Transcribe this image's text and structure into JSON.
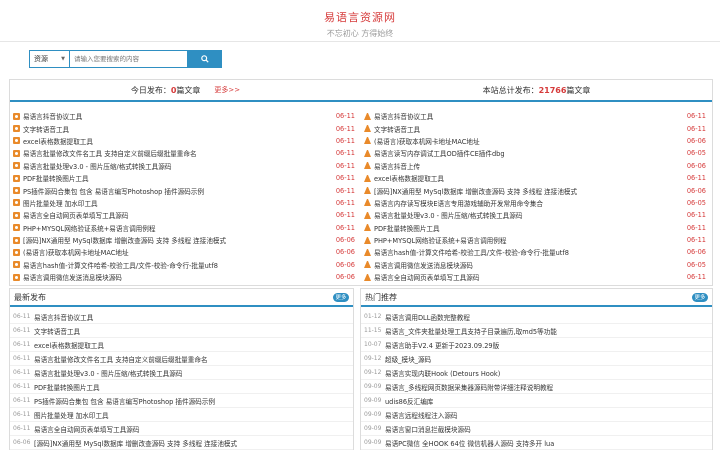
{
  "header": {
    "title": "易语言资源网",
    "slogan": "不忘初心 方得始终"
  },
  "search": {
    "select_value": "资源",
    "placeholder": "请输入您要搜索的内容"
  },
  "top": {
    "left_prefix": "今日发布：",
    "left_count": "0",
    "left_suffix": "篇文章",
    "left_more": "更多>>",
    "right_prefix": "本站总计发布：",
    "right_count": "21766",
    "right_suffix": "篇文章",
    "left_items": [
      {
        "title": "易语言抖音协议工具",
        "date": "06-11"
      },
      {
        "title": "文字转语音工具",
        "date": "06-11"
      },
      {
        "title": "excel表格数据提取工具",
        "date": "06-11"
      },
      {
        "title": "易语言批量修改文件名工具 支持自定义前缀后缀批量重命名",
        "date": "06-11"
      },
      {
        "title": "易语言批量处理v3.0 - 图片压缩/格式转换工具源码",
        "date": "06-11"
      },
      {
        "title": "PDF批量转换图片工具",
        "date": "06-11"
      },
      {
        "title": "PS插件源码合集包 包含 易语言编写Photoshop 插件源码示例",
        "date": "06-11"
      },
      {
        "title": "图片批量处理 加水印工具",
        "date": "06-11"
      },
      {
        "title": "易语言全自动网页表单填写工具源码",
        "date": "06-11"
      },
      {
        "title": "PHP+MYSQL网络验证系统+易语言调用例程",
        "date": "06-11"
      },
      {
        "title": "[源码]NX通用型 MySql数据库 增删改查源码 支持 多线程 连接池模式",
        "date": "06-06"
      },
      {
        "title": "(易语言)获取本机网卡地址MAC地址",
        "date": "06-06"
      },
      {
        "title": "易语言hash值-计算文件哈希-校验工具/文件-校验-命令行-批量utf8",
        "date": "06-06"
      },
      {
        "title": "易语言调用微信发送消息模块源码",
        "date": "06-06"
      }
    ],
    "right_items": [
      {
        "title": "易语言抖音协议工具",
        "date": "06-11"
      },
      {
        "title": "文字转语音工具",
        "date": "06-11"
      },
      {
        "title": "(易语言)获取本机网卡地址MAC地址",
        "date": "06-06"
      },
      {
        "title": "易语言读写内存调试工具OD插件CE插件dbg",
        "date": "06-05"
      },
      {
        "title": "易语言抖音上传",
        "date": "06-06"
      },
      {
        "title": "excel表格数据提取工具",
        "date": "06-11"
      },
      {
        "title": "[源码]NX通用型 MySql数据库 增删改查源码 支持 多线程 连接池模式",
        "date": "06-06"
      },
      {
        "title": "易语言内存读写模块E语言专用游戏辅助开发常用命令集合",
        "date": "06-05"
      },
      {
        "title": "易语言批量处理v3.0 - 图片压缩/格式转换工具源码",
        "date": "06-11"
      },
      {
        "title": "PDF批量转换图片工具",
        "date": "06-11"
      },
      {
        "title": "PHP+MYSQL网络验证系统+易语言调用例程",
        "date": "06-11"
      },
      {
        "title": "易语言hash值-计算文件哈希-校验工具/文件-校验-命令行-批量utf8",
        "date": "06-06"
      },
      {
        "title": "易语言调用微信发送消息模块源码",
        "date": "06-05"
      },
      {
        "title": "易语言全自动网页表单填写工具源码",
        "date": "06-11"
      }
    ]
  },
  "panel_left": {
    "title": "最新发布",
    "more": "更多",
    "items": [
      {
        "date": "06-11",
        "title": "易语言抖音协议工具"
      },
      {
        "date": "06-11",
        "title": "文字转语音工具"
      },
      {
        "date": "06-11",
        "title": "excel表格数据提取工具"
      },
      {
        "date": "06-11",
        "title": "易语言批量修改文件名工具 支持自定义前缀后缀批量重命名"
      },
      {
        "date": "06-11",
        "title": "易语言批量处理v3.0 - 图片压缩/格式转换工具源码"
      },
      {
        "date": "06-11",
        "title": "PDF批量转换图片工具"
      },
      {
        "date": "06-11",
        "title": "PS插件源码合集包 包含 易语言编写Photoshop 插件源码示例"
      },
      {
        "date": "06-11",
        "title": "图片批量处理 加水印工具"
      },
      {
        "date": "06-11",
        "title": "易语言全自动网页表单填写工具源码"
      },
      {
        "date": "06-06",
        "title": "[源码]NX通用型 MySql数据库 增删改查源码 支持 多线程 连接池模式"
      }
    ]
  },
  "panel_right": {
    "title": "热门推荐",
    "more": "更多",
    "items": [
      {
        "date": "01-12",
        "title": "易语言调用DLL函数完整教程"
      },
      {
        "date": "11-15",
        "title": "易语言_文件夹批量处理工具支持子目录遍历,取md5等功能"
      },
      {
        "date": "10-07",
        "title": "易语言助手V2.4 更新于2023.09.29版"
      },
      {
        "date": "09-12",
        "title": "超级_模块_源码"
      },
      {
        "date": "09-12",
        "title": "易语言实现内联Hook (Detours Hook)"
      },
      {
        "date": "09-09",
        "title": "易语言_多线程网页数据采集器源码附带详细注释说明教程"
      },
      {
        "date": "09-09",
        "title": "udis86反汇编库"
      },
      {
        "date": "09-09",
        "title": "易语言远程线程注入源码"
      },
      {
        "date": "09-09",
        "title": "易语言窗口消息拦截模块源码"
      },
      {
        "date": "09-09",
        "title": "易语PC微信 全HOOK 64位 微信机器人源码 支持多开 lua"
      }
    ]
  },
  "colors": {
    "accent": "#2f8fc2",
    "highlight": "#d63b3b",
    "icon": "#e98a2a"
  }
}
